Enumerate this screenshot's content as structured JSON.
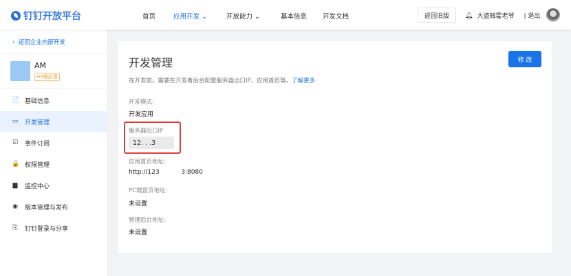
{
  "header": {
    "logo": "钉钉开放平台",
    "nav": [
      {
        "label": "首页"
      },
      {
        "label": "应用开发 ⌄"
      },
      {
        "label": "开放能力 ⌄"
      },
      {
        "label": "基本信息"
      },
      {
        "label": "开发文档"
      }
    ],
    "old_version": "返回旧版",
    "username": "大盗贼霍老爷",
    "logout": "| 退出"
  },
  "sidebar": {
    "back": "返回企业内部开发",
    "app_name": "AM",
    "app_tag": "H5微应用",
    "items": [
      {
        "label": "基础信息",
        "icon": "📄"
      },
      {
        "label": "开发管理",
        "icon": "▭"
      },
      {
        "label": "事件订阅",
        "icon": "☑"
      },
      {
        "label": "权限管理",
        "icon": "🔒"
      },
      {
        "label": "监控中心",
        "icon": "▆"
      },
      {
        "label": "版本管理与发布",
        "icon": "◉"
      },
      {
        "label": "钉钉登录与分享",
        "icon": "⎘"
      }
    ]
  },
  "main": {
    "title": "开发管理",
    "edit": "修 改",
    "desc": "在开发前，需要在开发者后台配置服务器出口IP、应用首页等。",
    "learn_more": "了解更多",
    "fields": [
      {
        "label": "开发模式:",
        "value": "开发应用"
      },
      {
        "label": "服务器出口IP",
        "value": "12.   .  .3"
      },
      {
        "label": "应用首页地址:",
        "value": "http://123           3:8080"
      },
      {
        "label": "PC端首页地址:",
        "value": "未设置"
      },
      {
        "label": "管理后台地址:",
        "value": "未设置"
      }
    ]
  },
  "colors": {
    "accent": "#1a73e8",
    "highlight": "#e03a3a"
  }
}
